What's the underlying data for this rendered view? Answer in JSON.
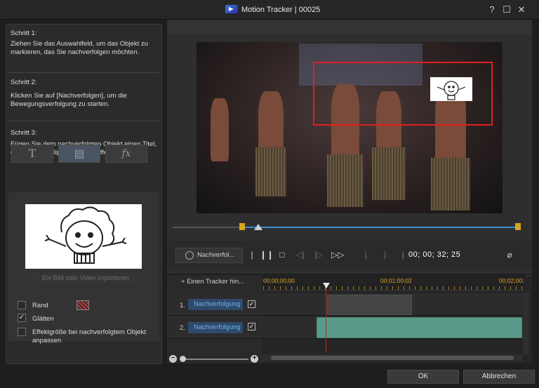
{
  "window": {
    "title": "Motion Tracker | 00025",
    "help_glyph": "?",
    "maximize_glyph": "☐",
    "close_glyph": "✕"
  },
  "steps": [
    {
      "title": "Schritt 1:",
      "text": "Ziehen Sie das Auswahlfeld, um das Objekt zu markieren, das Sie nachverfolgen möchten."
    },
    {
      "title": "Schritt 2:",
      "text": "Klicken Sie auf [Nachverfolgen], um die Bewegungsverfolgung zu starten."
    },
    {
      "title": "Schritt 3:",
      "text": "Fügen Sie dem nachverfolgten Objekt einen Titel, einen Medienclip oder einen Effekt hinzu."
    }
  ],
  "tools": {
    "title_glyph": "T",
    "media_glyph": "▤",
    "effect_glyph": "fx"
  },
  "import_button": "Ein Bild oder Video importieren",
  "options": {
    "border_label": "Rand",
    "smooth_label": "Glätten",
    "smooth_checked": true,
    "resize_label": "Effektgröße bei nachverfolgtem Objekt anpassen"
  },
  "controls": {
    "track_label": "Nachverfol...",
    "timecode": "00; 00; 32; 25"
  },
  "timeline": {
    "add_tracker_label": "Einen Tracker hin...",
    "ruler": [
      "00;00;00;00",
      "00;01;00;02",
      "00;02;00;"
    ],
    "tracks": [
      {
        "num": "1.",
        "name": "Nachverfolgung",
        "checked": true
      },
      {
        "num": "2.",
        "name": "Nachverfolgung",
        "checked": true
      }
    ]
  },
  "footer": {
    "ok": "OK",
    "cancel": "Abbrechen"
  },
  "colors": {
    "tracker_box": "#e02020",
    "accent": "#3a8fd0",
    "marker": "#d9a520"
  }
}
